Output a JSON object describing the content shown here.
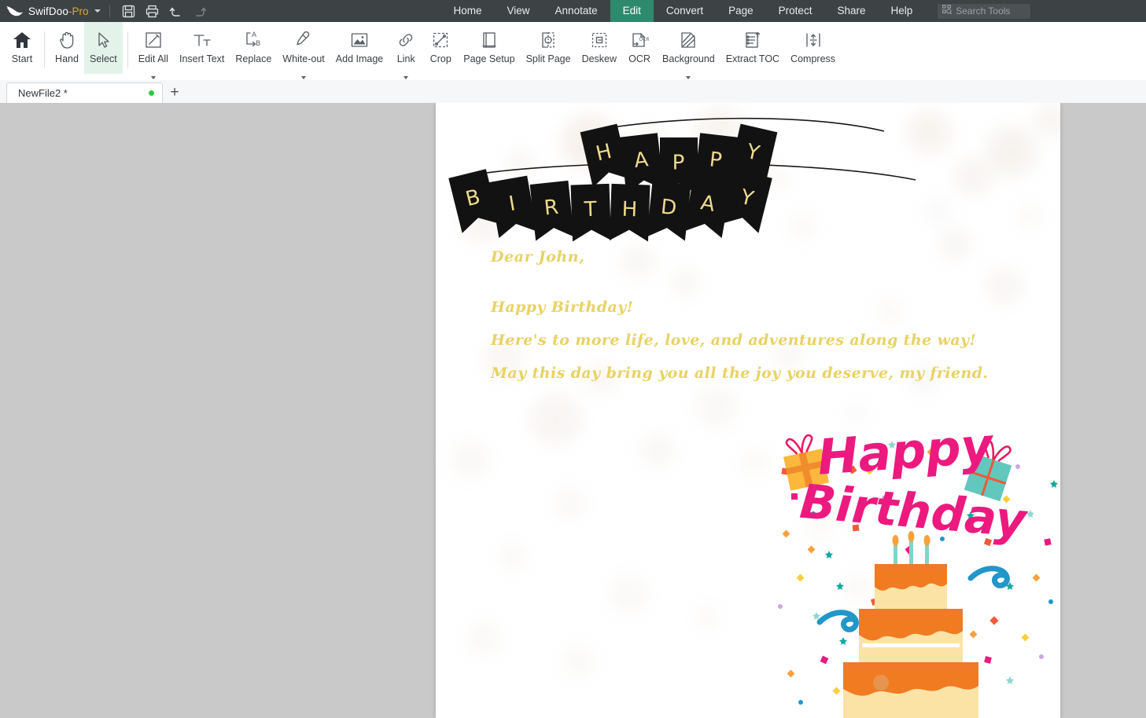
{
  "app": {
    "brand_name": "SwifDoo",
    "brand_suffix": "-Pro",
    "brand_caret_icon": "chevron-down-icon",
    "quick_actions": [
      {
        "name": "save-icon",
        "label": "Save"
      },
      {
        "name": "print-icon",
        "label": "Print"
      },
      {
        "name": "undo-icon",
        "label": "Undo"
      },
      {
        "name": "redo-icon",
        "label": "Redo"
      }
    ]
  },
  "menu": {
    "items": [
      {
        "label": "Home",
        "active": false
      },
      {
        "label": "View",
        "active": false
      },
      {
        "label": "Annotate",
        "active": false
      },
      {
        "label": "Edit",
        "active": true
      },
      {
        "label": "Convert",
        "active": false
      },
      {
        "label": "Page",
        "active": false
      },
      {
        "label": "Protect",
        "active": false
      },
      {
        "label": "Share",
        "active": false
      },
      {
        "label": "Help",
        "active": false
      }
    ],
    "active_tab": "Edit"
  },
  "search": {
    "placeholder": "Search Tools",
    "icon": "search-tools-icon"
  },
  "ribbon": {
    "buttons": [
      {
        "label": "Start",
        "icon": "home-icon",
        "caret": false,
        "selected": false,
        "sep_after": true
      },
      {
        "label": "Hand",
        "icon": "hand-icon",
        "caret": false,
        "selected": false,
        "sep_after": false
      },
      {
        "label": "Select",
        "icon": "cursor-arrow-icon",
        "caret": false,
        "selected": true,
        "sep_after": true
      },
      {
        "label": "Edit All",
        "icon": "edit-pencil-icon",
        "caret": true,
        "selected": false,
        "sep_after": false
      },
      {
        "label": "Insert Text",
        "icon": "insert-text-icon",
        "caret": false,
        "selected": false,
        "sep_after": false
      },
      {
        "label": "Replace",
        "icon": "replace-ab-icon",
        "caret": false,
        "selected": false,
        "sep_after": false
      },
      {
        "label": "White-out",
        "icon": "whiteout-icon",
        "caret": true,
        "selected": false,
        "sep_after": false
      },
      {
        "label": "Add Image",
        "icon": "add-image-icon",
        "caret": false,
        "selected": false,
        "sep_after": false
      },
      {
        "label": "Link",
        "icon": "link-icon",
        "caret": true,
        "selected": false,
        "sep_after": false
      },
      {
        "label": "Crop",
        "icon": "crop-icon",
        "caret": false,
        "selected": false,
        "sep_after": false
      },
      {
        "label": "Page Setup",
        "icon": "page-setup-icon",
        "caret": false,
        "selected": false,
        "sep_after": false
      },
      {
        "label": "Split Page",
        "icon": "split-page-icon",
        "caret": false,
        "selected": false,
        "sep_after": false
      },
      {
        "label": "Deskew",
        "icon": "deskew-icon",
        "caret": false,
        "selected": false,
        "sep_after": false
      },
      {
        "label": "OCR",
        "icon": "ocr-icon",
        "caret": false,
        "selected": false,
        "sep_after": false
      },
      {
        "label": "Background",
        "icon": "background-icon",
        "caret": true,
        "selected": false,
        "sep_after": false
      },
      {
        "label": "Extract TOC",
        "icon": "extract-toc-icon",
        "caret": false,
        "selected": false,
        "sep_after": false
      },
      {
        "label": "Compress",
        "icon": "compress-icon",
        "caret": false,
        "selected": false,
        "sep_after": false
      }
    ]
  },
  "tabbar": {
    "tabs": [
      {
        "title": "NewFile2 *",
        "modified": true
      }
    ],
    "add_tab_label": "+"
  },
  "document": {
    "banner_text": "HAPPY BIRTHDAY",
    "banner_line1": "HAPPY",
    "banner_line2": "BIRTHDAY",
    "letter": {
      "salutation": "Dear John,",
      "lines": [
        "Happy Birthday!",
        "Here's to more life, love, and adventures along the way!",
        "May this day bring you all the joy you deserve, my friend."
      ]
    },
    "artwork": {
      "title_line1": "Happy",
      "title_line2": "Birthday",
      "elements": [
        "gift-box-yellow",
        "gift-box-teal",
        "layer-cake",
        "candles",
        "confetti",
        "streamers"
      ]
    }
  },
  "colors": {
    "titlebar_bg": "#3d4245",
    "accent_green": "#2f8a6d",
    "brand_orange": "#e8a33d",
    "ribbon_bg": "#ffffff",
    "selected_tool_bg": "#e4f3ea",
    "workspace_bg": "#c9c9c9",
    "page_bg": "#ffffff",
    "letter_gold": "#e8d265",
    "banner_flag_black": "#121212",
    "banner_letter_gold": "#efd98b",
    "artwork_pink": "#ec1a7f",
    "cake_orange": "#f07b21",
    "cake_cream": "#fbe3a5",
    "modified_dot_green": "#2ecc40"
  }
}
